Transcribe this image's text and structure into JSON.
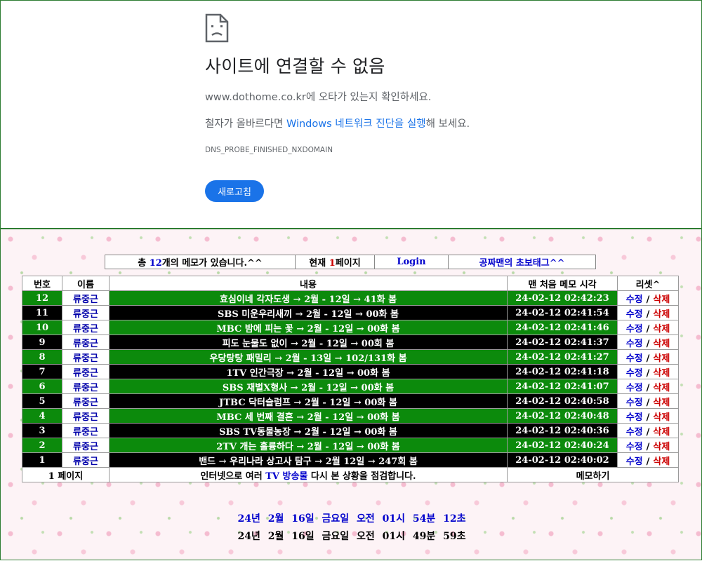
{
  "error_page": {
    "title": "사이트에 연결할 수 없음",
    "line1": "www.dothome.co.kr에 오타가 있는지 확인하세요.",
    "line2_prefix": "철자가 올바르다면 ",
    "line2_link": "Windows 네트워크 진단을 실행",
    "line2_suffix": "해 보세요.",
    "error_code": "DNS_PROBE_FINISHED_NXDOMAIN",
    "reload_label": "새로고침",
    "icon": "sad-page-icon"
  },
  "info_bar": {
    "total_prefix": "총 ",
    "total_count": "12",
    "total_suffix": "개의 메모가 있습니다.^^",
    "current_prefix": "현재 ",
    "current_page": "1",
    "current_suffix": "페이지",
    "login_label": "Login",
    "tag_link_label": "공짜맨의 초보태그^^"
  },
  "memo_table": {
    "headers": {
      "num": "번호",
      "name": "이름",
      "content": "내용",
      "time": "맨 처음 메모 시각",
      "reset": "리셋^"
    },
    "edit_label": "수정",
    "sep": "/",
    "delete_label": "삭제",
    "rows": [
      {
        "num": "12",
        "name": "류중근",
        "content": "효심이네 각자도생 → 2월 - 12일 → 41화 봄",
        "time": "24-02-12 02:42:23",
        "color": "green"
      },
      {
        "num": "11",
        "name": "류중근",
        "content": "SBS 미운우리새끼 → 2월 - 12일 → 00화 봄",
        "time": "24-02-12 02:41:54",
        "color": "black"
      },
      {
        "num": "10",
        "name": "류중근",
        "content": "MBC 밤에 피는 꽃 → 2월 - 12일 → 00화 봄",
        "time": "24-02-12 02:41:46",
        "color": "green"
      },
      {
        "num": "9",
        "name": "류중근",
        "content": "피도 눈물도 없이 → 2월 - 12일 → 00회 봄",
        "time": "24-02-12 02:41:37",
        "color": "black"
      },
      {
        "num": "8",
        "name": "류중근",
        "content": "우당탕탕 패밀리 → 2월 - 13일 → 102/131화 봄",
        "time": "24-02-12 02:41:27",
        "color": "green"
      },
      {
        "num": "7",
        "name": "류중근",
        "content": "1TV 인간극장 → 2월 - 12일 → 00화 봄",
        "time": "24-02-12 02:41:18",
        "color": "black"
      },
      {
        "num": "6",
        "name": "류중근",
        "content": "SBS 재벌X형사 → 2월 - 12일 → 00화 봄",
        "time": "24-02-12 02:41:07",
        "color": "green"
      },
      {
        "num": "5",
        "name": "류중근",
        "content": "JTBC 닥터슬럼프 → 2월 - 12일 → 00화 봄",
        "time": "24-02-12 02:40:58",
        "color": "black"
      },
      {
        "num": "4",
        "name": "류중근",
        "content": "MBC 세 번째 결혼 → 2월 - 12일 → 00화 봄",
        "time": "24-02-12 02:40:48",
        "color": "green"
      },
      {
        "num": "3",
        "name": "류중근",
        "content": "SBS TV동물농장 → 2월 - 12일 → 00화 봄",
        "time": "24-02-12 02:40:36",
        "color": "black"
      },
      {
        "num": "2",
        "name": "류중근",
        "content": "2TV 개는 훌륭하다 → 2월 - 12일 → 00화 봄",
        "time": "24-02-12 02:40:24",
        "color": "green"
      },
      {
        "num": "1",
        "name": "류중근",
        "content": "밴드 → 우리나라 상고사 탐구 → 2월 12일 → 247회 봄",
        "time": "24-02-12 02:40:02",
        "color": "black"
      }
    ],
    "footer": {
      "page_label": "1 페이지",
      "msg_prefix": "인터넷으로 여러 ",
      "msg_link": "TV 방송물",
      "msg_suffix": " 다시 본 상황을 점검합니다.",
      "memo_button": "메모하기"
    }
  },
  "clocks": {
    "clock1": "24년 2월 16일 금요일 오전 01시 54분 12초",
    "clock2": "24년 2월 16일 금요일 오전 01시 49분 59초"
  }
}
